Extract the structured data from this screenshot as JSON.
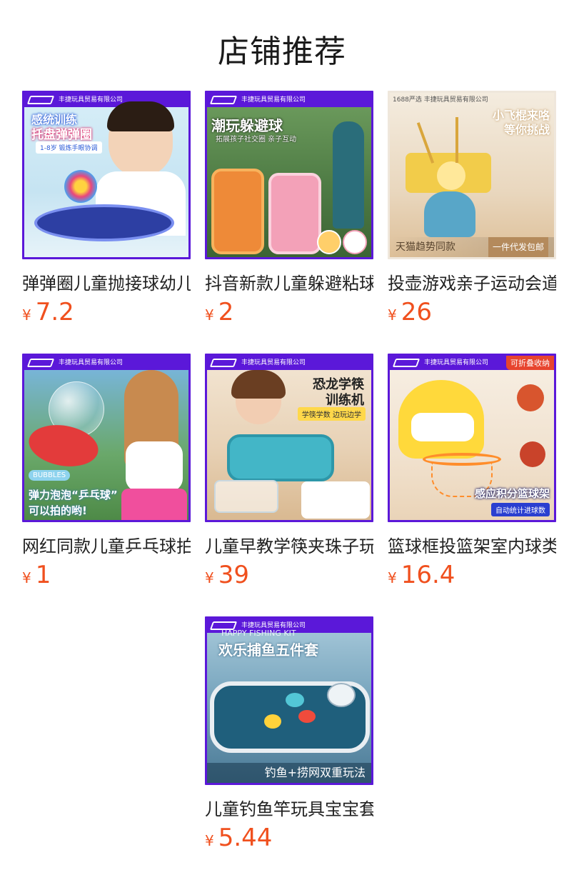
{
  "section_title": "店铺推荐",
  "accent_color": "#5b18d9",
  "price_color": "#f0501e",
  "products": [
    {
      "thumb_brand": "丰捷玩具贸易有限公司",
      "thumb_lines": [
        "感统训练",
        "托盘弹弹圈",
        "1-8岁  锻炼手眼协调"
      ],
      "name": "弹弹圈儿童抛接球幼儿园",
      "currency": "¥",
      "price": "7.2"
    },
    {
      "thumb_brand": "丰捷玩具贸易有限公司",
      "thumb_lines": [
        "潮玩躲避球",
        "拓展孩子社交圈 亲子互动"
      ],
      "name": "抖音新款儿童躲避粘球",
      "currency": "¥",
      "price": "2"
    },
    {
      "thumb_brand": "丰捷玩具贸易有限公司",
      "thumb_lines": [
        "1688严选",
        "小飞棍来咯",
        "等你挑战",
        "天猫趋势同款",
        "一件代发包邮"
      ],
      "name": "投壶游戏亲子运动会道具",
      "currency": "¥",
      "price": "26"
    },
    {
      "thumb_brand": "丰捷玩具贸易有限公司",
      "thumb_lines": [
        "BUBBLES",
        "弹力泡泡“乒乓球”",
        "可以拍的哟!"
      ],
      "name": "网红同款儿童乒乓球拍",
      "currency": "¥",
      "price": "1"
    },
    {
      "thumb_brand": "丰捷玩具贸易有限公司",
      "thumb_lines": [
        "恐龙学筷",
        "训练机",
        "学筷学数 边玩边学"
      ],
      "name": "儿童早教学筷夹珠子玩具",
      "currency": "¥",
      "price": "39"
    },
    {
      "thumb_brand": "丰捷玩具贸易有限公司",
      "thumb_lines": [
        "可折叠收纳",
        "感应积分篮球架",
        "自动统计进球数"
      ],
      "name": "篮球框投篮架室内球类",
      "currency": "¥",
      "price": "16.4"
    },
    {
      "thumb_brand": "丰捷玩具贸易有限公司",
      "thumb_lines": [
        "HAPPY FISHING KIT",
        "欢乐捕鱼五件套",
        "钓鱼+捞网双重玩法"
      ],
      "name": "儿童钓鱼竿玩具宝宝套装",
      "currency": "¥",
      "price": "5.44"
    }
  ]
}
